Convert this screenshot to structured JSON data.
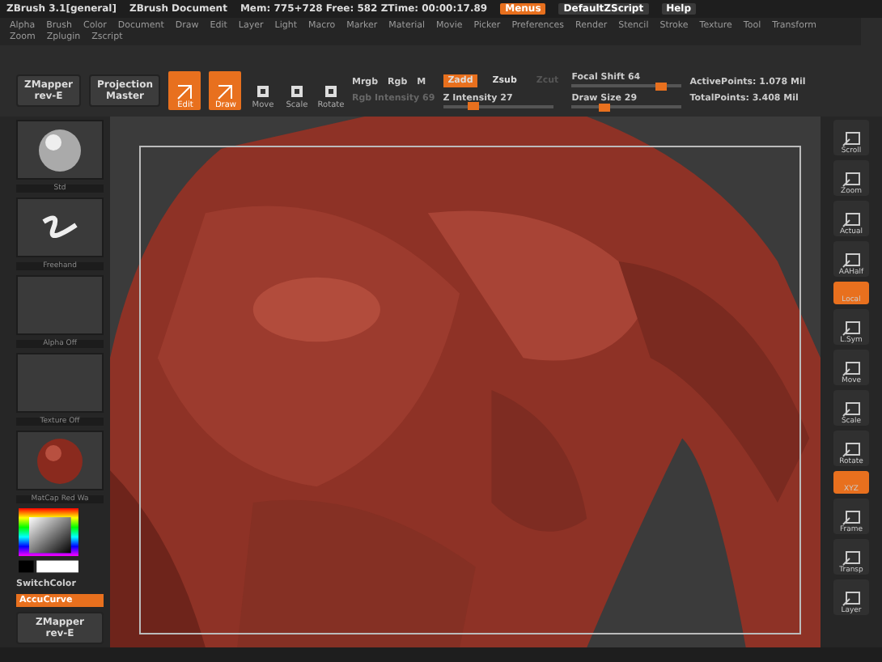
{
  "title_bar": {
    "app": "ZBrush 3.1[general]",
    "document": "ZBrush Document",
    "stats": "Mem: 775+728 Free: 582 ZTime: 00:00:17.89",
    "buttons": [
      {
        "label": "Menus",
        "selected": true
      },
      {
        "label": "DefaultZScript",
        "selected": false
      },
      {
        "label": "Help",
        "selected": false
      }
    ]
  },
  "menu": [
    "Alpha",
    "Brush",
    "Color",
    "Document",
    "Draw",
    "Edit",
    "Layer",
    "Light",
    "Macro",
    "Marker",
    "Material",
    "Movie",
    "Picker",
    "Preferences",
    "Render",
    "Stencil",
    "Stroke",
    "Texture",
    "Tool",
    "Transform",
    "Zoom",
    "Zplugin",
    "Zscript"
  ],
  "toolbar": {
    "plugins": [
      {
        "label": "ZMapper",
        "sub": "rev-E"
      },
      {
        "label": "Projection",
        "sub": "Master"
      }
    ],
    "modes": [
      {
        "label": "Edit",
        "kind": "big",
        "selected": true
      },
      {
        "label": "Draw",
        "kind": "big",
        "selected": true
      },
      {
        "label": "Move",
        "kind": "small",
        "selected": false
      },
      {
        "label": "Scale",
        "kind": "small",
        "selected": false
      },
      {
        "label": "Rotate",
        "kind": "small",
        "selected": false
      }
    ],
    "color_modes": [
      {
        "label": "Mrgb",
        "disabled": false
      },
      {
        "label": "Rgb",
        "disabled": false
      },
      {
        "label": "M",
        "disabled": false
      }
    ],
    "rgb_intensity": {
      "label": "Rgb Intensity 69",
      "disabled": true
    },
    "z_modes": [
      {
        "label": "Zadd",
        "selected": true,
        "disabled": false
      },
      {
        "label": "Zsub",
        "selected": false,
        "disabled": false
      },
      {
        "label": "Zcut",
        "selected": false,
        "disabled": true
      }
    ],
    "sliders": [
      {
        "label": "Z Intensity 27",
        "level": 0.27
      },
      {
        "label": "Focal Shift 64",
        "level": 0.82
      },
      {
        "label": "Draw Size 29",
        "level": 0.3
      }
    ],
    "stats": [
      "ActivePoints: 1.078 Mil",
      "TotalPoints: 3.408 Mil"
    ]
  },
  "left_shelf": {
    "thumbnails": [
      {
        "label": "Std",
        "kind": "sphere"
      },
      {
        "label": "Freehand",
        "kind": "stroke"
      },
      {
        "label": "Alpha Off",
        "kind": "empty"
      },
      {
        "label": "Texture Off",
        "kind": "empty"
      },
      {
        "label": "MatCap Red Wa",
        "kind": "material"
      }
    ],
    "switch_color": "SwitchColor",
    "accucurve": {
      "label": "AccuCurve",
      "selected": true
    },
    "plugin": {
      "label": "ZMapper",
      "sub": "rev-E"
    }
  },
  "right_shelf": [
    {
      "label": "Scroll",
      "selected": false
    },
    {
      "label": "Zoom",
      "selected": false
    },
    {
      "label": "Actual",
      "selected": false
    },
    {
      "label": "AAHalf",
      "selected": false
    },
    {
      "label": "Local",
      "selected": true
    },
    {
      "label": "L.Sym",
      "selected": false
    },
    {
      "label": "Move",
      "selected": false
    },
    {
      "label": "Scale",
      "selected": false
    },
    {
      "label": "Rotate",
      "selected": false
    },
    {
      "label": "XYZ",
      "selected": true
    },
    {
      "label": "Frame",
      "selected": false
    },
    {
      "label": "Transp",
      "selected": false
    },
    {
      "label": "Layer",
      "selected": false
    }
  ]
}
